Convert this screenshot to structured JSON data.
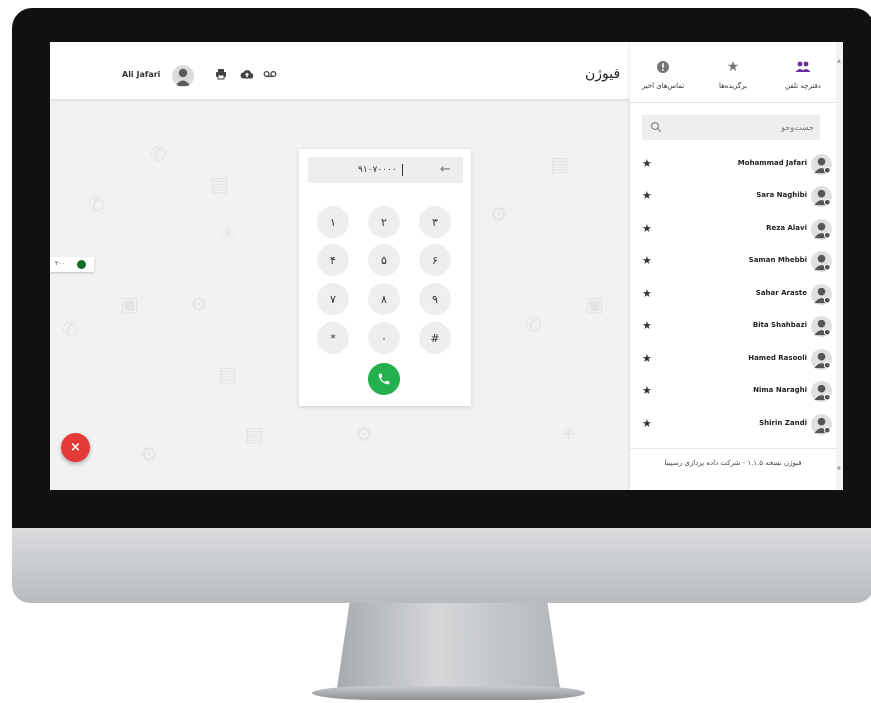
{
  "topbar": {
    "user_name": "Ali Jafari",
    "brand": "فیوژن",
    "icons": [
      "user-avatar-icon",
      "print-icon",
      "cloud-upload-icon",
      "voicemail-icon"
    ]
  },
  "status_badge": {
    "text": "۲۰۰",
    "color": "#0f6b2e"
  },
  "dialer": {
    "number": "۹۱۰۷۰۰۰۰",
    "keys": [
      "۱",
      "۲",
      "۳",
      "۴",
      "۵",
      "۶",
      "۷",
      "۸",
      "۹",
      "*",
      "۰",
      "#"
    ],
    "call_color": "#22b14c"
  },
  "fab": {
    "label": "×",
    "color": "#e53935"
  },
  "sidebar": {
    "tabs": [
      {
        "label": "دفترچه تلفن",
        "icon": "contacts-icon",
        "color": "#6a2d9c"
      },
      {
        "label": "برگزیده‌ها",
        "icon": "star-icon",
        "color": "#757575"
      },
      {
        "label": "تماس‌های اخیر",
        "icon": "alert-circle-icon",
        "color": "#757575"
      }
    ],
    "search_placeholder": "جست‌وجو",
    "contacts": [
      "Mohammad Jafari",
      "Sara Naghibi",
      "Reza Alavi",
      "Saman Mhebbi",
      "Sahar Araste",
      "Bita Shahbazi",
      "Hamed Rasooli",
      "Nima Naraghi",
      "Shirin Zandi"
    ],
    "footer": "فیوژن نسخه ۱.۱.۵ - شرکت داده پردازی رسپینا"
  }
}
